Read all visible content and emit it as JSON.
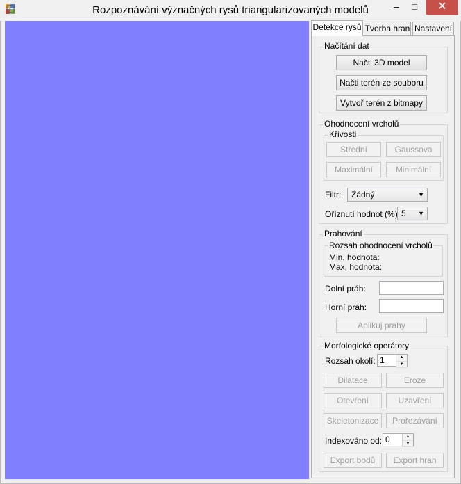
{
  "window": {
    "title": "Rozpoznávání význačných rysů triangularizovaných modelů",
    "min_glyph": "–",
    "max_glyph": "□",
    "close_glyph": "✕"
  },
  "viewport": {
    "color": "#8080ff"
  },
  "tabs": [
    {
      "label": "Detekce rysů",
      "selected": true
    },
    {
      "label": "Tvorba hran",
      "selected": false
    },
    {
      "label": "Nastavení",
      "selected": false
    }
  ],
  "nacitani": {
    "title": "Načítání dat",
    "load_model": "Načti 3D model",
    "load_terrain": "Načti terén ze souboru",
    "create_terrain": "Vytvoř terén z bitmapy"
  },
  "ohodnoceni": {
    "title": "Ohodnocení vrcholů",
    "krivosti": {
      "title": "Křivosti",
      "stredni": "Střední",
      "gaussova": "Gaussova",
      "maximalni": "Maximální",
      "minimalni": "Minimální"
    },
    "filter_label": "Filtr:",
    "filter_value": "Žádný",
    "cut_label": "Oříznutí hodnot (%):",
    "cut_value": "5"
  },
  "prahovani": {
    "title": "Prahování",
    "range_title": "Rozsah ohodnocení vrcholů",
    "min_label": "Min. hodnota:",
    "max_label": "Max. hodnota:",
    "lower_label": "Dolní práh:",
    "upper_label": "Horní práh:",
    "apply": "Aplikuj prahy"
  },
  "morfo": {
    "title": "Morfologické operátory",
    "range_label": "Rozsah okolí:",
    "range_value": "1",
    "dilatace": "Dilatace",
    "eroze": "Eroze",
    "otevreni": "Otevření",
    "uzavreni": "Uzavření",
    "skeleton": "Skeletonizace",
    "prorezavani": "Prořezávání",
    "index_label": "Indexováno od:",
    "index_value": "0",
    "export_body": "Export bodů",
    "export_hran": "Export hran"
  }
}
